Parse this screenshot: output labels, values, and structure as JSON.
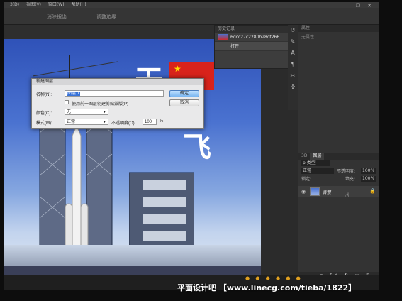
{
  "menubar": {
    "items": [
      "3(D)",
      "视图(V)",
      "窗口(W)",
      "帮助(H)"
    ]
  },
  "optbar": {
    "items": [
      "消除锯齿",
      "调整边缘..."
    ]
  },
  "window_controls": "— ❐ ✕",
  "history_panel": {
    "header": "历史记录",
    "snapshot_name": "6dcc27c2280b28df266...",
    "rows": [
      "打开"
    ]
  },
  "properties_panel": {
    "header": "属性",
    "empty_text": "无属性"
  },
  "layers_panel": {
    "tabs": [
      "3D",
      "图层"
    ],
    "kind_label": "p 类型",
    "blend_mode": "正常",
    "opacity_label": "不透明度:",
    "opacity_value": "100%",
    "lock_label": "锁定:",
    "fill_label": "填充:",
    "fill_value": "100%",
    "layer_name": "背景",
    "footer_icons": "∞ fx ◐ ▭ ⊞ 🗑"
  },
  "canvas": {
    "big_chars": [
      "天",
      "飞"
    ]
  },
  "dialog": {
    "title": "新建图层",
    "name_label": "名称(N):",
    "name_value": "图层 1",
    "clip_checkbox_label": "使用前一图层创建剪贴蒙版(P)",
    "color_label": "颜色(C):",
    "color_value": "无",
    "mode_label": "模式(M):",
    "mode_value": "正常",
    "opacity_label": "不透明度(O):",
    "opacity_value": "100",
    "opacity_unit": "%",
    "ok_label": "确定",
    "cancel_label": "取消"
  },
  "watermark": "平面设计吧 【www.linecg.com/tieba/1822】",
  "colors": {
    "accent_blue": "#3873d9",
    "flag_red": "#d8231b",
    "flag_star": "#ffde00"
  }
}
